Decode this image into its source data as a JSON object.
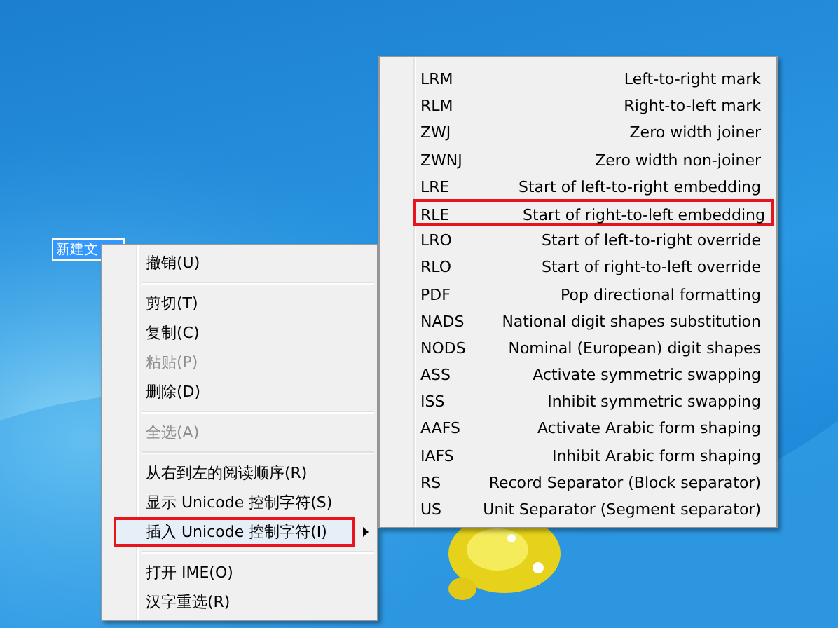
{
  "desktop_icon": {
    "label": "新建文",
    "selected": true
  },
  "context_menu": {
    "items": [
      {
        "kind": "item",
        "label": "撤销(U)",
        "disabled": false,
        "selected": false
      },
      {
        "kind": "separator"
      },
      {
        "kind": "item",
        "label": "剪切(T)",
        "disabled": false,
        "selected": false
      },
      {
        "kind": "item",
        "label": "复制(C)",
        "disabled": false,
        "selected": false
      },
      {
        "kind": "item",
        "label": "粘贴(P)",
        "disabled": true,
        "selected": false
      },
      {
        "kind": "item",
        "label": "删除(D)",
        "disabled": false,
        "selected": false
      },
      {
        "kind": "separator"
      },
      {
        "kind": "item",
        "label": "全选(A)",
        "disabled": true,
        "selected": false
      },
      {
        "kind": "separator"
      },
      {
        "kind": "item",
        "label": "从右到左的阅读顺序(R)",
        "disabled": false,
        "selected": false
      },
      {
        "kind": "item",
        "label": "显示 Unicode 控制字符(S)",
        "disabled": false,
        "selected": false
      },
      {
        "kind": "submenu",
        "label": "插入 Unicode 控制字符(I)",
        "disabled": false,
        "selected": true
      },
      {
        "kind": "separator"
      },
      {
        "kind": "item",
        "label": "打开 IME(O)",
        "disabled": false,
        "selected": false
      },
      {
        "kind": "item",
        "label": "汉字重选(R)",
        "disabled": false,
        "selected": false
      }
    ]
  },
  "submenu": {
    "items": [
      {
        "code": "LRM",
        "description": "Left-to-right mark",
        "selected": false
      },
      {
        "code": "RLM",
        "description": "Right-to-left mark",
        "selected": false
      },
      {
        "code": "ZWJ",
        "description": "Zero width joiner",
        "selected": false
      },
      {
        "code": "ZWNJ",
        "description": "Zero width non-joiner",
        "selected": false
      },
      {
        "code": "LRE",
        "description": "Start of left-to-right embedding",
        "selected": false
      },
      {
        "code": "RLE",
        "description": "Start of right-to-left embedding",
        "selected": true
      },
      {
        "code": "LRO",
        "description": "Start of left-to-right override",
        "selected": false
      },
      {
        "code": "RLO",
        "description": "Start of right-to-left override",
        "selected": false
      },
      {
        "code": "PDF",
        "description": "Pop directional formatting",
        "selected": false
      },
      {
        "code": "NADS",
        "description": "National digit shapes substitution",
        "selected": false
      },
      {
        "code": "NODS",
        "description": "Nominal (European) digit shapes",
        "selected": false
      },
      {
        "code": "ASS",
        "description": "Activate symmetric swapping",
        "selected": false
      },
      {
        "code": "ISS",
        "description": "Inhibit symmetric swapping",
        "selected": false
      },
      {
        "code": "AAFS",
        "description": "Activate Arabic form shaping",
        "selected": false
      },
      {
        "code": "IAFS",
        "description": "Inhibit Arabic form shaping",
        "selected": false
      },
      {
        "code": "RS",
        "description": "Record Separator (Block separator)",
        "selected": false
      },
      {
        "code": "US",
        "description": "Unit Separator (Segment separator)",
        "selected": false
      }
    ]
  }
}
